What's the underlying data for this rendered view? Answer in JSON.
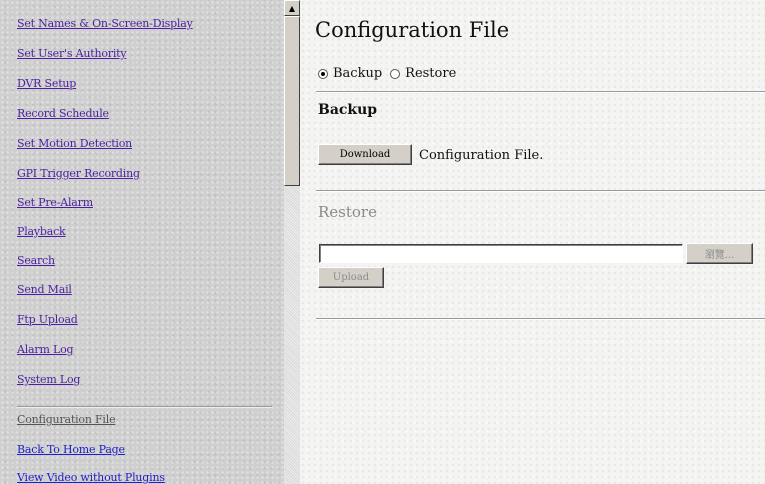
{
  "sidebar": {
    "items": [
      {
        "label": "Set Names & On-Screen-Display"
      },
      {
        "label": "Set User's Authority"
      },
      {
        "label": "DVR Setup"
      },
      {
        "label": "Record Schedule"
      },
      {
        "label": "Set Motion Detection"
      },
      {
        "label": "GPI Trigger Recording"
      },
      {
        "label": "Set Pre-Alarm"
      },
      {
        "label": "Playback"
      },
      {
        "label": "Search"
      },
      {
        "label": "Send Mail"
      },
      {
        "label": "Ftp Upload"
      },
      {
        "label": "Alarm Log"
      },
      {
        "label": "System Log"
      }
    ],
    "bottom_items": [
      {
        "label": "Configuration File"
      },
      {
        "label": "Back To Home Page"
      },
      {
        "label": "View Video without Plugins"
      }
    ],
    "scroll_up_glyph": "▲"
  },
  "main": {
    "title": "Configuration File",
    "mode": {
      "options": [
        "Backup",
        "Restore"
      ],
      "selected": "Backup"
    },
    "backup": {
      "heading": "Backup",
      "download_label": "Download",
      "description": "Configuration File."
    },
    "restore": {
      "heading": "Restore",
      "file_value": "",
      "browse_label": "瀏覽...",
      "upload_label": "Upload"
    }
  }
}
